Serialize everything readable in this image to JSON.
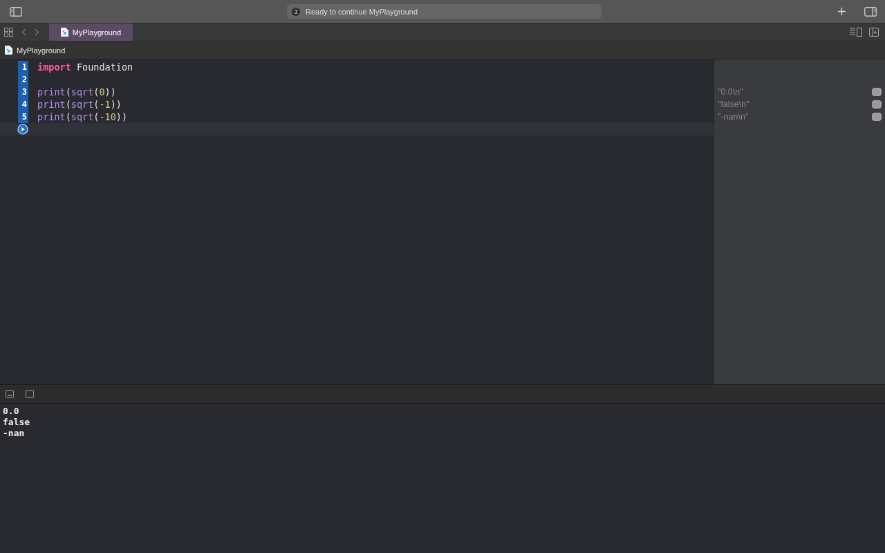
{
  "toolbar": {
    "status_count": "3",
    "status_text": "Ready to continue MyPlayground"
  },
  "tabs": [
    {
      "label": "MyPlayground",
      "selected": true
    }
  ],
  "breadcrumb": "MyPlayground",
  "code_lines": [
    {
      "number": "1",
      "executed": true,
      "tokens": [
        {
          "kind": "keyword",
          "text": "import"
        },
        {
          "kind": "plain",
          "text": " Foundation"
        }
      ]
    },
    {
      "number": "2",
      "executed": true
    },
    {
      "number": "3",
      "executed": true,
      "tokens": [
        {
          "kind": "func",
          "text": "print"
        },
        {
          "kind": "plain",
          "text": "("
        },
        {
          "kind": "func",
          "text": "sqrt"
        },
        {
          "kind": "plain",
          "text": "("
        },
        {
          "kind": "number",
          "text": "0"
        },
        {
          "kind": "plain",
          "text": "))"
        }
      ],
      "result": "\"0.0\\n\""
    },
    {
      "number": "4",
      "executed": true,
      "tokens": [
        {
          "kind": "func",
          "text": "print"
        },
        {
          "kind": "plain",
          "text": "("
        },
        {
          "kind": "func",
          "text": "sqrt"
        },
        {
          "kind": "plain",
          "text": "("
        },
        {
          "kind": "number",
          "text": "-1"
        },
        {
          "kind": "plain",
          "text": "))"
        }
      ],
      "result": "\"false\\n\""
    },
    {
      "number": "5",
      "executed": true,
      "tokens": [
        {
          "kind": "func",
          "text": "print"
        },
        {
          "kind": "plain",
          "text": "("
        },
        {
          "kind": "func",
          "text": "sqrt"
        },
        {
          "kind": "plain",
          "text": "("
        },
        {
          "kind": "number",
          "text": "-10"
        },
        {
          "kind": "plain",
          "text": "))"
        }
      ],
      "result": "\"-nan\\n\""
    }
  ],
  "console_output": [
    "0.0",
    "false",
    "-nan"
  ]
}
